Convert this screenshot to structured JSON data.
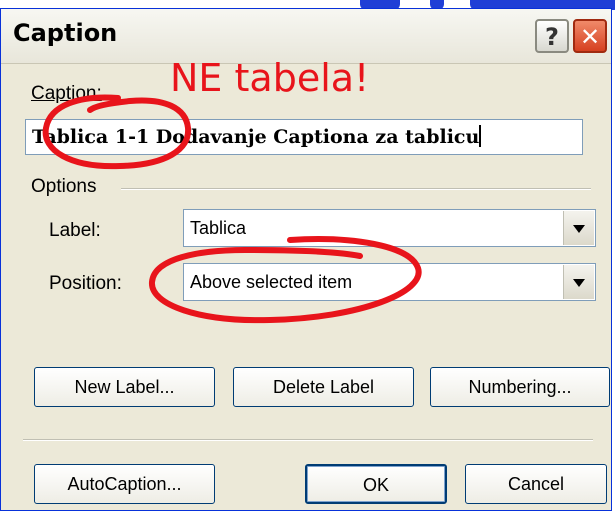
{
  "dialog": {
    "title": "Caption",
    "help_button": "?",
    "close_button": "✕"
  },
  "caption": {
    "label": "Caption:",
    "value": "Tablica 1-1 Dodavanje Captiona za tablicu"
  },
  "options": {
    "group_label": "Options",
    "label_field": {
      "label": "Label:",
      "value": "Tablica"
    },
    "position_field": {
      "label": "Position:",
      "value": "Above selected item"
    }
  },
  "buttons": {
    "new_label": "New Label...",
    "delete_label": "Delete Label",
    "numbering": "Numbering...",
    "autocaption": "AutoCaption...",
    "ok": "OK",
    "cancel": "Cancel"
  },
  "annotation": {
    "text": "NE tabela!",
    "color": "#e8141b"
  },
  "colors": {
    "dialog_bg": "#ece9d8",
    "border": "#0831d9"
  }
}
